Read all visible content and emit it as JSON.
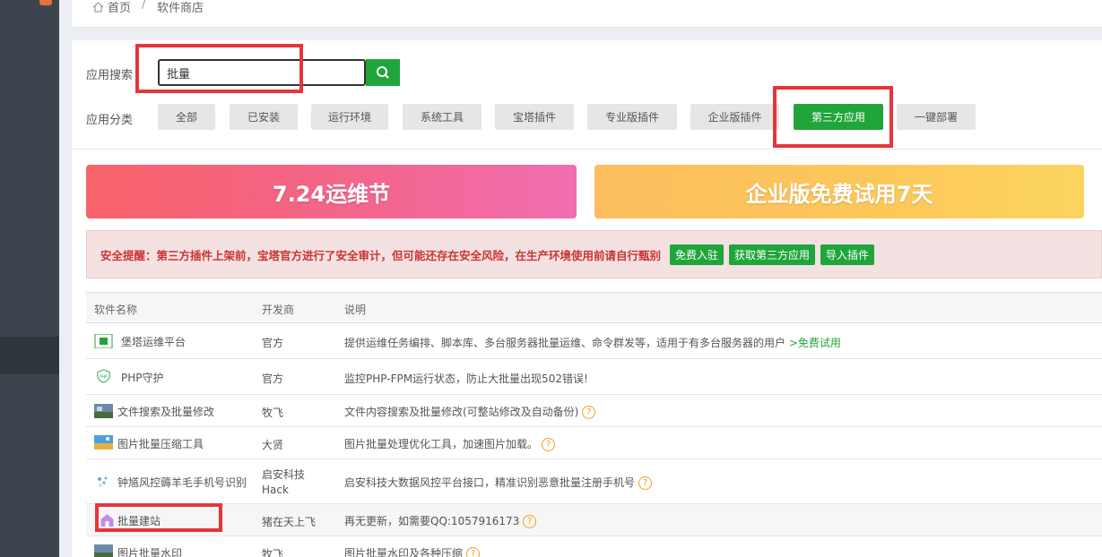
{
  "breadcrumb": {
    "home": "首页",
    "sep": "/",
    "current": "软件商店"
  },
  "search": {
    "label": "应用搜索",
    "value": "批量"
  },
  "categories": {
    "label": "应用分类",
    "items": [
      "全部",
      "已安装",
      "运行环境",
      "系统工具",
      "宝塔插件",
      "专业版插件",
      "企业版插件",
      "第三方应用",
      "一键部署"
    ],
    "active": "第三方应用"
  },
  "banners": {
    "left": "7.24运维节",
    "right": "企业版免费试用7天"
  },
  "alert": {
    "text": "安全提醒：第三方插件上架前，宝塔官方进行了安全审计，但可能还存在安全风险，在生产环境使用前请自行甄别",
    "buttons": [
      "免费入驻",
      "获取第三方应用",
      "导入插件"
    ]
  },
  "table": {
    "headers": [
      "软件名称",
      "开发商",
      "说明"
    ],
    "rows": [
      {
        "name": "堡塔运维平台",
        "dev": "官方",
        "desc": "提供运维任务编排、脚本库、多台服务器批量运维、命令群发等，适用于有多台服务器的用户",
        "link": ">免费试用",
        "help": ""
      },
      {
        "name": "PHP守护",
        "dev": "官方",
        "desc": "监控PHP-FPM运行状态，防止大批量出现502错误!",
        "link": "",
        "help": ""
      },
      {
        "name": "文件搜索及批量修改",
        "dev": "牧飞",
        "desc": "文件内容搜索及批量修改(可整站修改及自动备份)",
        "link": "",
        "help": "?"
      },
      {
        "name": "图片批量压缩工具",
        "dev": "大贤",
        "desc": "图片批量处理优化工具，加速图片加载。",
        "link": "",
        "help": "?"
      },
      {
        "name": "钟馗风控薅羊毛手机号识别",
        "dev": "启安科技 Hack",
        "desc": "启安科技大数据风控平台接口，精准识别恶意批量注册手机号",
        "link": "",
        "help": "?"
      },
      {
        "name": "批量建站",
        "dev": "猪在天上飞",
        "desc": "再无更新，如需要QQ:1057916173",
        "link": "",
        "help": "?"
      },
      {
        "name": "图片批量水印",
        "dev": "牧飞",
        "desc": "图片批量水印及各种压缩",
        "link": "",
        "help": "?"
      }
    ]
  },
  "colors": {
    "accent": "#20a53a",
    "highlight_box": "#e8343a",
    "sidebar": "#3c444d"
  }
}
